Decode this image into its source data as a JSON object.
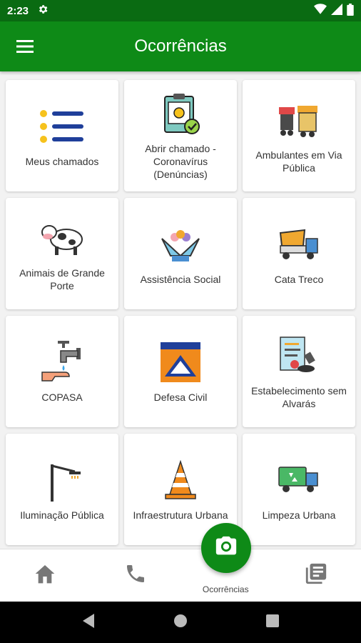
{
  "status_bar": {
    "time": "2:23"
  },
  "app_bar": {
    "title": "Ocorrências"
  },
  "services": [
    {
      "label": "Meus chamados",
      "icon": "list-icon"
    },
    {
      "label": "Abrir chamado - Coronavírus (Denúncias)",
      "icon": "clipboard-virus-icon"
    },
    {
      "label": "Ambulantes em Via Pública",
      "icon": "street-vendor-icon"
    },
    {
      "label": "Animais de Grande Porte",
      "icon": "cow-icon"
    },
    {
      "label": "Assistência Social",
      "icon": "helping-hands-icon"
    },
    {
      "label": "Cata Treco",
      "icon": "dump-truck-icon"
    },
    {
      "label": "COPASA",
      "icon": "water-tap-icon"
    },
    {
      "label": "Defesa Civil",
      "icon": "civil-defense-icon"
    },
    {
      "label": "Estabelecimento sem Alvarás",
      "icon": "license-stamp-icon"
    },
    {
      "label": "Iluminação Pública",
      "icon": "street-light-icon"
    },
    {
      "label": "Infraestrutura Urbana",
      "icon": "traffic-cone-icon"
    },
    {
      "label": "Limpeza Urbana",
      "icon": "garbage-truck-icon"
    }
  ],
  "bottom_nav": {
    "home": "home-icon",
    "phone": "phone-icon",
    "center_label": "Ocorrências",
    "news": "news-icon"
  },
  "colors": {
    "primary": "#0e8a17",
    "status": "#0a6b12"
  }
}
